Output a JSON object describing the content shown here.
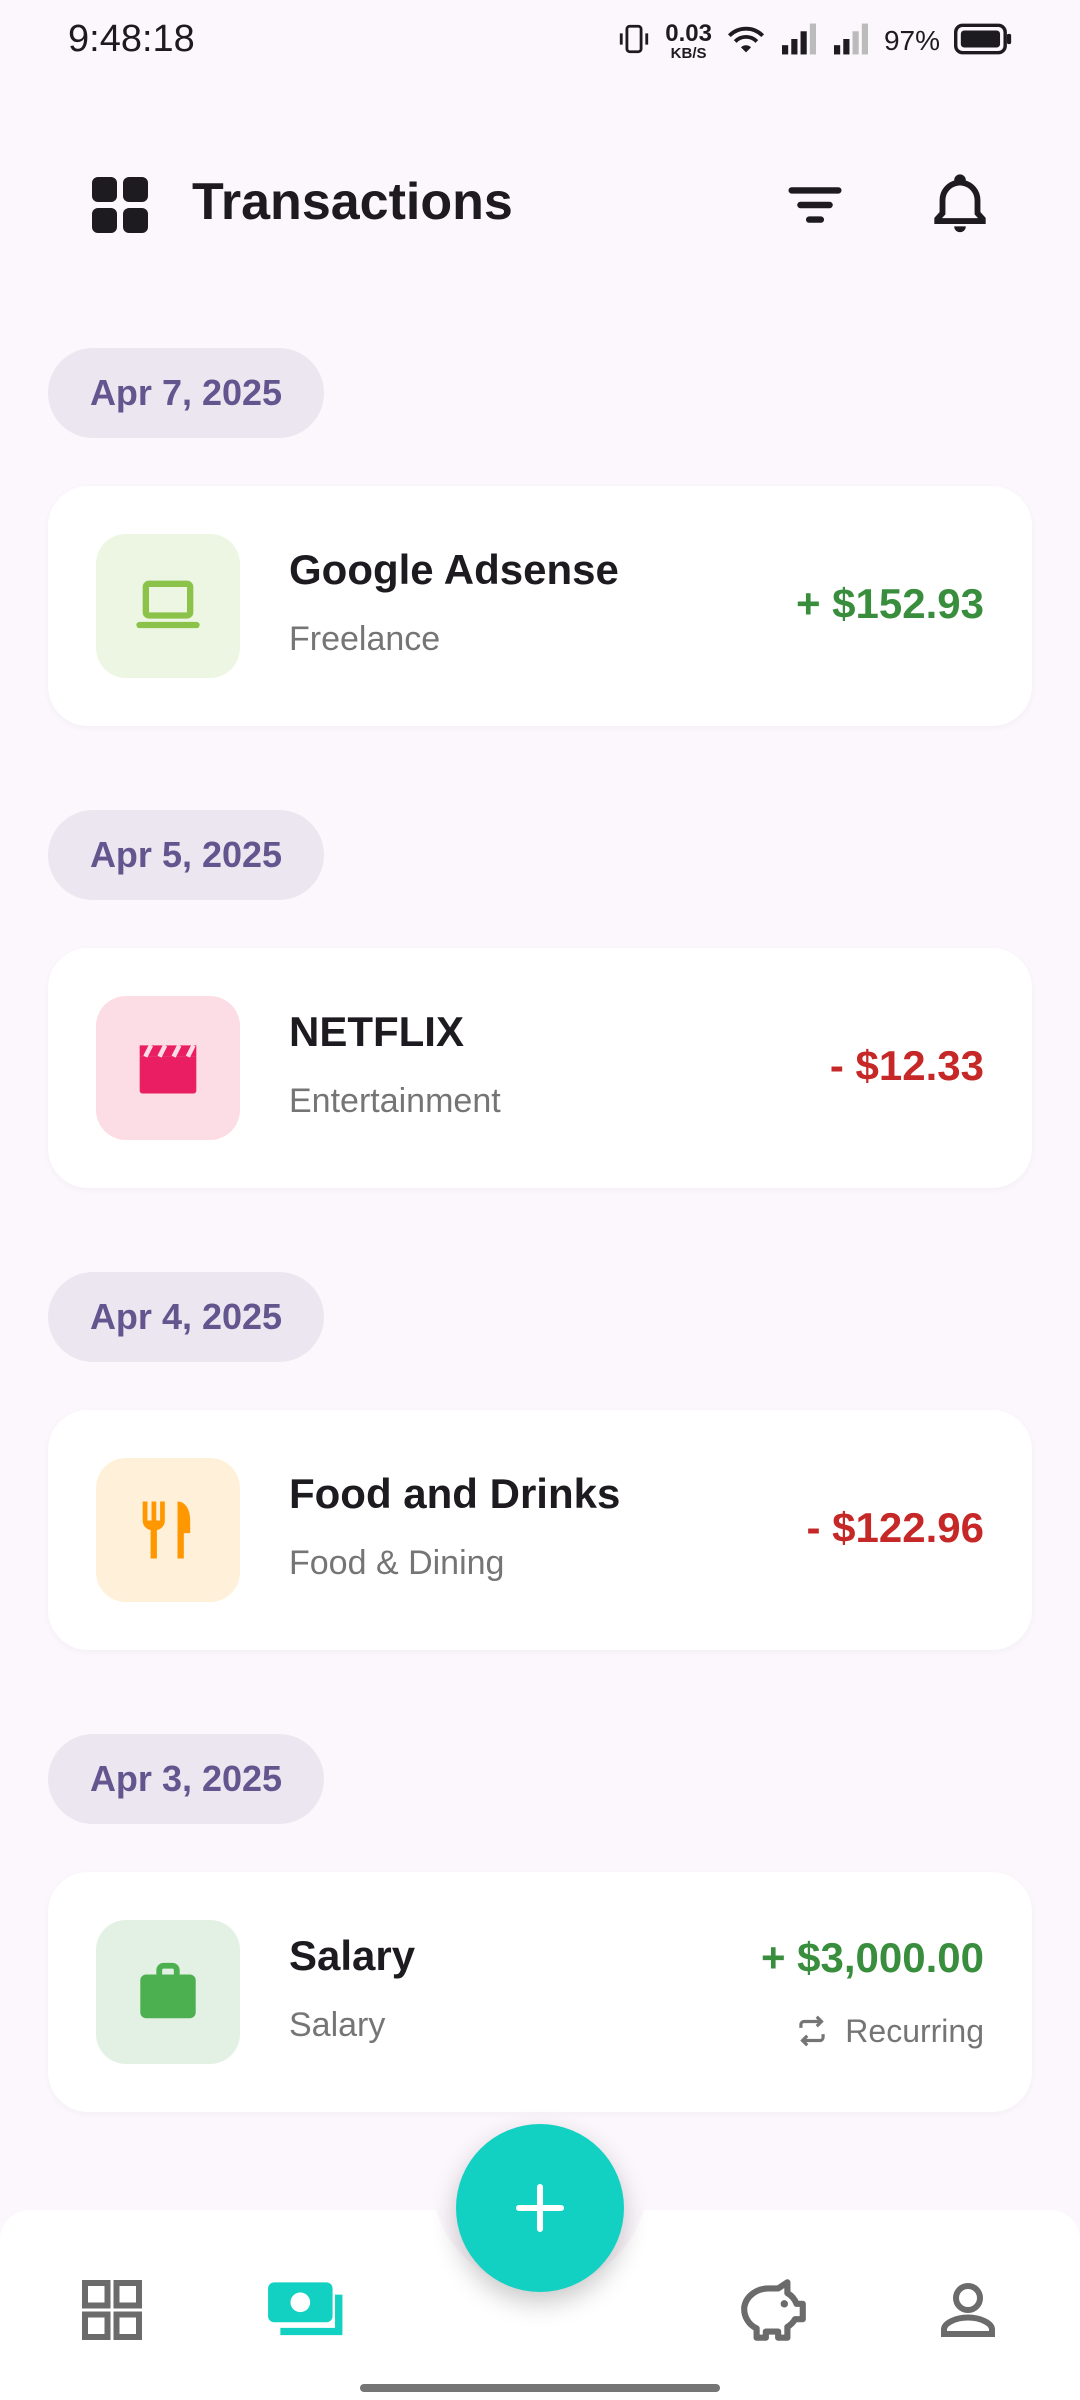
{
  "status_bar": {
    "time": "9:48:18",
    "net_speed_value": "0.03",
    "net_speed_unit": "KB/S",
    "battery": "97%"
  },
  "app_bar": {
    "title": "Transactions",
    "icons": [
      "dashboard-icon",
      "filter-icon",
      "bell-icon"
    ]
  },
  "transactions": [
    {
      "date": "Apr 7, 2025",
      "title": "Google Adsense",
      "category": "Freelance",
      "amount": "+ $152.93",
      "type": "income",
      "icon": "laptop-icon",
      "icon_bg": "#edf6e3",
      "icon_color": "#8bc34a"
    },
    {
      "date": "Apr 5, 2025",
      "title": "NETFLIX",
      "category": "Entertainment",
      "amount": "- $12.33",
      "type": "expense",
      "icon": "movie-clapper-icon",
      "icon_bg": "#fcdde6",
      "icon_color": "#e91e63"
    },
    {
      "date": "Apr 4, 2025",
      "title": "Food and Drinks",
      "category": "Food & Dining",
      "amount": "- $122.96",
      "type": "expense",
      "icon": "restaurant-icon",
      "icon_bg": "#fff0d9",
      "icon_color": "#ff9800"
    },
    {
      "date": "Apr 3, 2025",
      "title": "Salary",
      "category": "Salary",
      "amount": "+ $3,000.00",
      "type": "income",
      "recurring_label": "Recurring",
      "icon": "briefcase-icon",
      "icon_bg": "#e3f1e4",
      "icon_color": "#4caf50"
    }
  ],
  "colors": {
    "income": "#388e3c",
    "expense": "#c62828",
    "accent": "#12d1c2",
    "chip_text": "#65558f"
  },
  "bottom_nav": {
    "items": [
      {
        "name": "dashboard",
        "icon": "grid-icon",
        "active": false
      },
      {
        "name": "transactions",
        "icon": "money-icon",
        "active": true
      },
      {
        "name": "savings",
        "icon": "piggy-bank-icon",
        "active": false
      },
      {
        "name": "profile",
        "icon": "person-icon",
        "active": false
      }
    ],
    "fab_icon": "plus-icon"
  }
}
